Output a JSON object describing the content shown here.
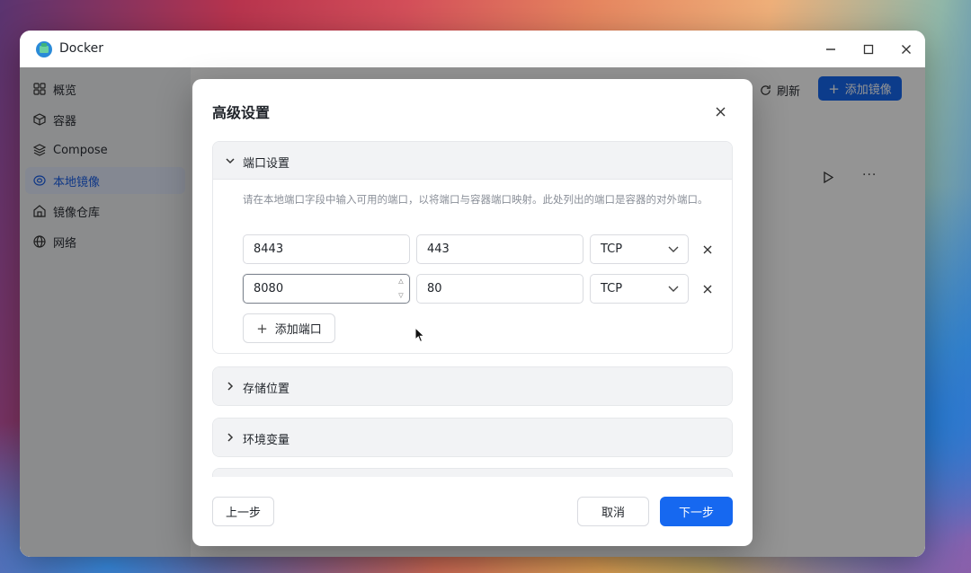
{
  "window": {
    "title": "Docker",
    "controls": {
      "minimize": "minimize-icon",
      "maximize": "maximize-icon",
      "close": "close-icon"
    }
  },
  "sidebar": {
    "items": [
      {
        "label": "概览",
        "icon": "grid-icon",
        "active": false
      },
      {
        "label": "容器",
        "icon": "cube-icon",
        "active": false
      },
      {
        "label": "Compose",
        "icon": "layers-icon",
        "active": false
      },
      {
        "label": "本地镜像",
        "icon": "disk-icon",
        "active": true
      },
      {
        "label": "镜像仓库",
        "icon": "home-icon",
        "active": false
      },
      {
        "label": "网络",
        "icon": "globe-icon",
        "active": false
      }
    ]
  },
  "toolbar": {
    "refresh_label": "刷新",
    "add_image_label": "添加镜像"
  },
  "modal": {
    "title": "高级设置",
    "sections": {
      "ports": {
        "label": "端口设置",
        "expanded": true,
        "description": "请在本地端口字段中输入可用的端口，以将端口与容器端口映射。此处列出的端口是容器的对外端口。",
        "rows": [
          {
            "local_port": "8443",
            "container_port": "443",
            "protocol": "TCP"
          },
          {
            "local_port": "8080",
            "container_port": "80",
            "protocol": "TCP"
          }
        ],
        "add_port_label": "添加端口"
      },
      "storage": {
        "label": "存储位置",
        "expanded": false
      },
      "env": {
        "label": "环境变量",
        "expanded": false
      }
    },
    "buttons": {
      "prev": "上一步",
      "cancel": "取消",
      "next": "下一步"
    }
  },
  "colors": {
    "primary": "#1668f0",
    "active_nav_bg": "#e3ebfb",
    "active_nav_text": "#1a5fe8"
  }
}
